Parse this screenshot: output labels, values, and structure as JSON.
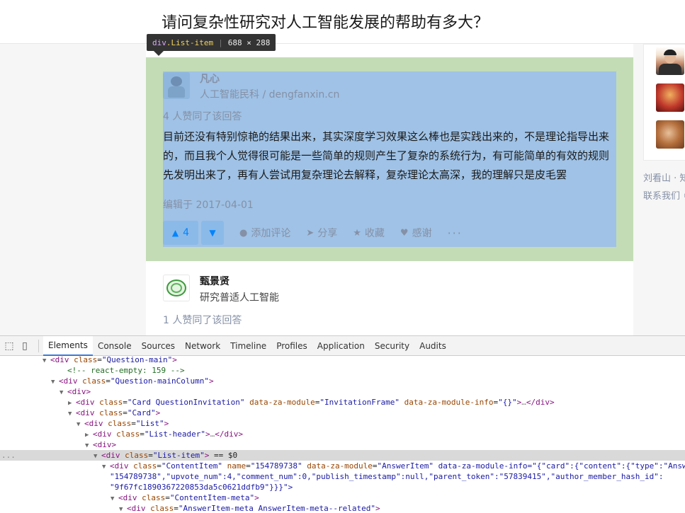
{
  "question": {
    "title": "请问复杂性研究对人工智能发展的帮助有多大？"
  },
  "inspector_tooltip": {
    "tag": "div",
    "class": ".List-item",
    "dimensions": "688 × 288"
  },
  "answers": [
    {
      "author_name": "凡心",
      "author_bio": "人工智能民科 / dengfanxin.cn",
      "upvote_text": "4 人赞同了该回答",
      "content_lines": [
        "目前还没有特别惊艳的结果出来，其实深度学习效果这么棒也是实践出来的，不是理论指导出来",
        "的，而且我个人觉得很可能是一些简单的规则产生了复杂的系统行为，有可能简单的有效的规则",
        "先发明出来了，再有人尝试用复杂理论去解释，复杂理论太高深，我的理解只是皮毛罢"
      ],
      "edited": "编辑于 2017-04-01",
      "actions": {
        "vote_up_count": "4",
        "comment": "添加评论",
        "share": "分享",
        "collect": "收藏",
        "thanks": "感谢",
        "more": "···"
      }
    },
    {
      "author_name": "甄景贤",
      "author_bio": "研究普适人工智能",
      "upvote_text": "1 人赞同了该回答"
    }
  ],
  "sidebar": {
    "link_line_1": "刘看山 · 知",
    "link_line_2": "联系我们 ©"
  },
  "devtools": {
    "tabs": [
      "Elements",
      "Console",
      "Sources",
      "Network",
      "Timeline",
      "Profiles",
      "Application",
      "Security",
      "Audits"
    ],
    "active_tab": "Elements",
    "dom_lines": [
      {
        "indent": 5,
        "tri": "▼",
        "html": "<div class=\"Question-main\">"
      },
      {
        "indent": 7,
        "tri": "",
        "html": "<!-- react-empty: 159 -->"
      },
      {
        "indent": 6,
        "tri": "▼",
        "html": "<div class=\"Question-mainColumn\">"
      },
      {
        "indent": 7,
        "tri": "▼",
        "html": "<div>"
      },
      {
        "indent": 8,
        "tri": "▶",
        "html": "<div class=\"Card QuestionInvitation\" data-za-module=\"InvitationFrame\" data-za-module-info=\"{}\">…</div>"
      },
      {
        "indent": 8,
        "tri": "▼",
        "html": "<div class=\"Card\">"
      },
      {
        "indent": 9,
        "tri": "▼",
        "html": "<div class=\"List\">"
      },
      {
        "indent": 10,
        "tri": "▶",
        "html": "<div class=\"List-header\">…</div>"
      },
      {
        "indent": 10,
        "tri": "▼",
        "html": "<div>"
      },
      {
        "indent": 11,
        "tri": "▼",
        "html": "<div class=\"List-item\"> == $0"
      },
      {
        "indent": 12,
        "tri": "▼",
        "html": "<div class=\"ContentItem\" name=\"154789738\" data-za-module=\"AnswerItem\" data-za-module-info=\"{\"card\":{\"content\":{\"type\":\"Answer\""
      },
      {
        "indent": 12,
        "tri": "",
        "html": "\"154789738\",\"upvote_num\":4,\"comment_num\":0,\"publish_timestamp\":null,\"parent_token\":\"57839415\",\"author_member_hash_id\":"
      },
      {
        "indent": 12,
        "tri": "",
        "html": "\"9f67fc1890367220853da5c0621ddfb9\"}}}\">"
      },
      {
        "indent": 13,
        "tri": "▼",
        "html": "<div class=\"ContentItem-meta\">"
      },
      {
        "indent": 14,
        "tri": "▼",
        "html": "<div class=\"AnswerItem-meta AnswerItem-meta--related\">"
      }
    ],
    "selected_marker": "..."
  }
}
